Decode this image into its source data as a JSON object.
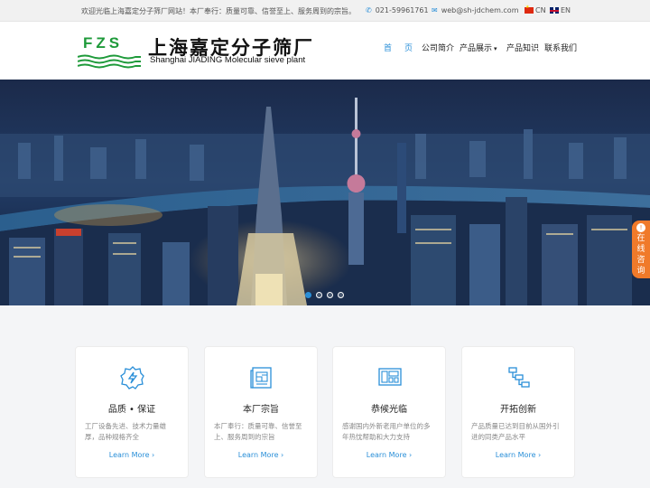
{
  "topbar": {
    "welcome": "欢迎光临上海嘉定分子筛厂网站！本厂奉行：质量可靠、信誉至上、服务周到的宗旨。",
    "phone": "021-59961761",
    "email": "web@sh-jdchem.com",
    "lang_cn": "CN",
    "lang_en": "EN"
  },
  "logo": {
    "mark": "FZS",
    "name_cn": "上海嘉定分子筛厂",
    "name_en": "Shanghai JIADING Molecular sieve plant"
  },
  "nav": {
    "items": [
      "首页",
      "公司简介",
      "产品展示",
      "产品知识",
      "联系我们"
    ]
  },
  "hero": {
    "slides": 4,
    "active_slide": 1
  },
  "consult": {
    "label": "在线咨询"
  },
  "cards": [
    {
      "icon": "lightning-badge-icon",
      "title": "品质 • 保证",
      "desc": "工厂设备先进、技术力量雄厚，品种规格齐全",
      "more": "Learn More"
    },
    {
      "icon": "blueprint-icon",
      "title": "本厂宗旨",
      "desc": "本厂奉行：质量可靠、信誉至上、服务周到的宗旨",
      "more": "Learn More"
    },
    {
      "icon": "layout-icon",
      "title": "恭候光临",
      "desc": "感谢国内外新老用户单位的多年热忱帮助和大力支持",
      "more": "Learn More"
    },
    {
      "icon": "flowchart-icon",
      "title": "开拓创新",
      "desc": "产品质量已达到目前从国外引进的同类产品水平",
      "more": "Learn More"
    }
  ],
  "colors": {
    "accent": "#2a8fd8",
    "logo_green": "#1e9a3a",
    "consult_orange": "#f07a2a"
  }
}
